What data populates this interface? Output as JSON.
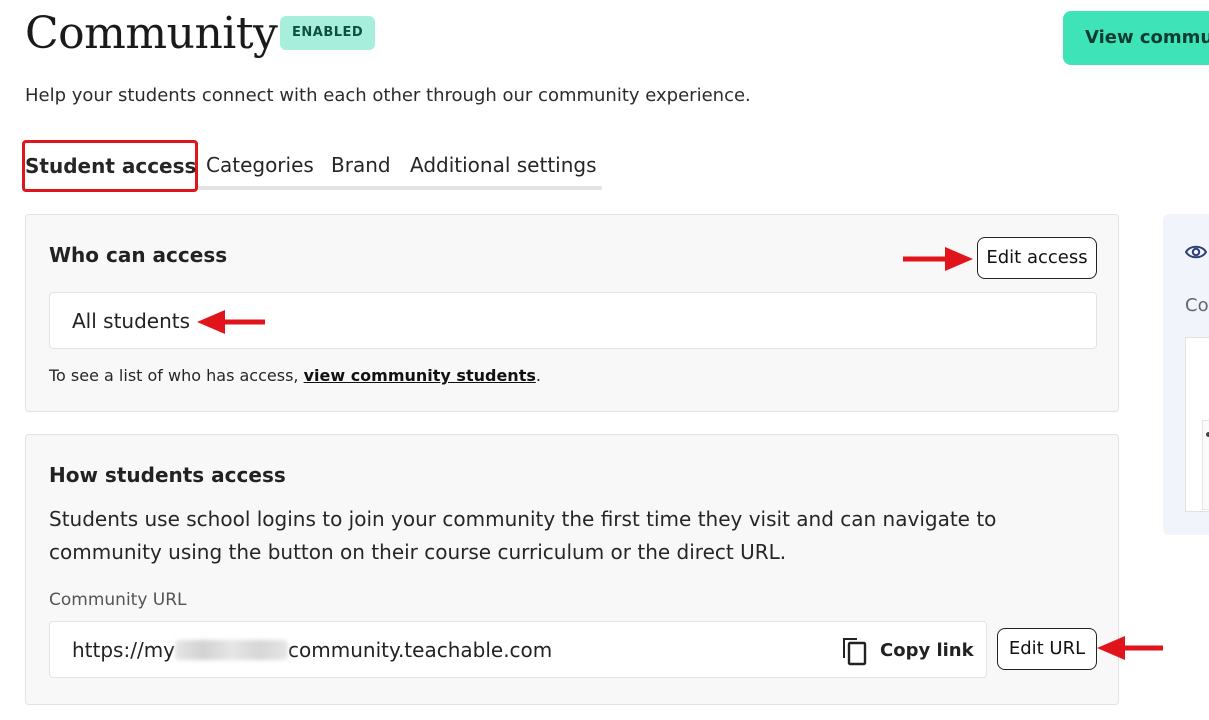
{
  "header": {
    "title": "Community",
    "status_badge": "ENABLED",
    "view_button": "View community"
  },
  "subtitle": "Help your students connect with each other through our community experience.",
  "tabs": [
    {
      "label": "Student access",
      "active": true
    },
    {
      "label": "Categories",
      "active": false
    },
    {
      "label": "Brand",
      "active": false
    },
    {
      "label": "Additional settings",
      "active": false
    }
  ],
  "who_can_access": {
    "title": "Who can access",
    "edit_button": "Edit access",
    "value": "All students",
    "helper_prefix": "To see a list of who has access, ",
    "helper_link": "view community students",
    "helper_suffix": "."
  },
  "how_students_access": {
    "title": "How students access",
    "description": "Students use school logins to join your community the first time they visit and can navigate to community using the button on their course curriculum or the direct URL.",
    "url_label": "Community URL",
    "url_prefix": "https://my",
    "url_suffix": "community.teachable.com",
    "copy_link": "Copy link",
    "edit_url_button": "Edit URL"
  },
  "side_panel": {
    "text": "Co",
    "icon": "eye-icon"
  },
  "colors": {
    "accent": "#3fe3b8",
    "badge_bg": "#a8eedc",
    "annotation_red": "#e0141a"
  }
}
